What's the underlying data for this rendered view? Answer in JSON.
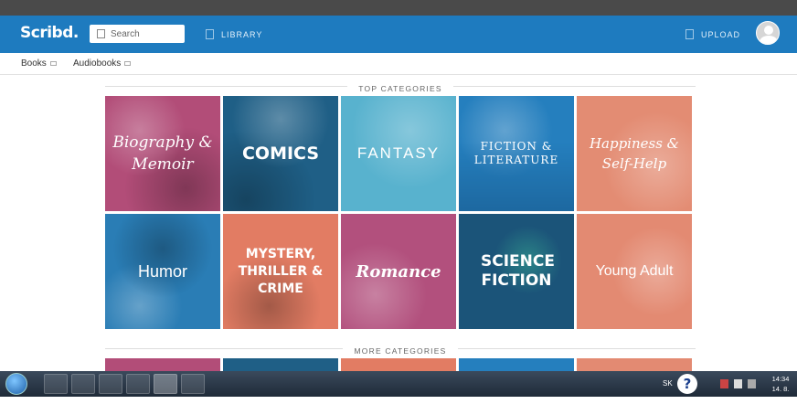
{
  "header": {
    "logo": "Scribd.",
    "search_placeholder": "Search",
    "library_label": "LIBRARY",
    "upload_label": "UPLOAD"
  },
  "subnav": {
    "items": [
      {
        "label": "Books"
      },
      {
        "label": "Audiobooks"
      }
    ]
  },
  "sections": {
    "top": "TOP CATEGORIES",
    "more": "MORE CATEGORIES"
  },
  "categories": [
    {
      "label": "Biography & Memoir",
      "color": "#b24d78"
    },
    {
      "label": "COMICS",
      "color": "#1f5f86"
    },
    {
      "label": "FANTASY",
      "color": "#58b2ce"
    },
    {
      "label": "FICTION & LITERATURE",
      "color": "#257fbe"
    },
    {
      "label": "Happiness & Self-Help",
      "color": "#e38c73"
    },
    {
      "label": "Humor",
      "color": "#2a7db5"
    },
    {
      "label": "MYSTERY, THRILLER & CRIME",
      "color": "#e27c63"
    },
    {
      "label": "Romance",
      "color": "#b2507d"
    },
    {
      "label": "SCIENCE FICTION",
      "color": "#1b5479"
    },
    {
      "label": "Young Adult",
      "color": "#e38a72"
    }
  ],
  "more_categories_colors": [
    "#b24d78",
    "#1f5f86",
    "#e27c63",
    "#257fbe",
    "#e38a72"
  ],
  "taskbar": {
    "language": "SK",
    "help_glyph": "?",
    "time": "14:34",
    "date": "14. 8. 2015"
  }
}
